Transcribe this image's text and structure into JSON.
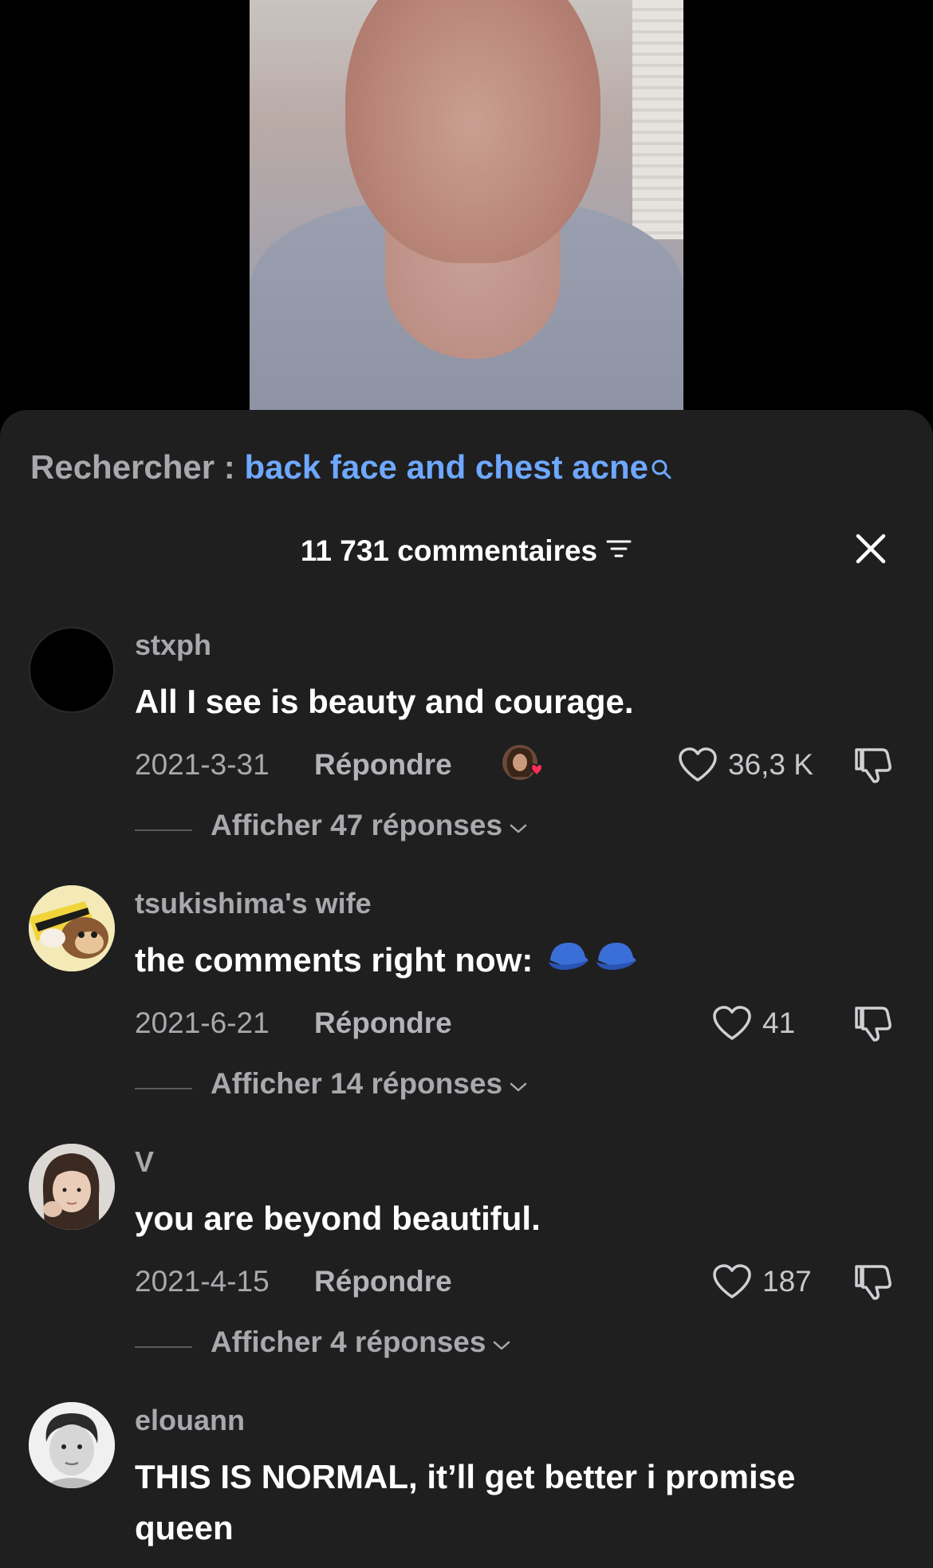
{
  "search": {
    "prefix": "Rechercher : ",
    "term": "back face and chest acne",
    "icon": "search-icon"
  },
  "header": {
    "count_label": "11 731 commentaires",
    "sort_icon": "sort-icon",
    "close_icon": "close-icon"
  },
  "colors": {
    "sheet_background": "#1f1f20",
    "accent_link": "#6ea8ff",
    "muted_text": "#a9a9ad",
    "liked_badge": "#fe2c55"
  },
  "comments": [
    {
      "username": "stxph",
      "text": "All I see is beauty and courage.",
      "date": "2021-3-31",
      "reply_label": "Répondre",
      "liked_by_creator": true,
      "likes": "36,3 K",
      "replies_label": "Afficher 47 réponses"
    },
    {
      "username": "tsukishima's wife",
      "text": "the comments right now:",
      "date": "2021-6-21",
      "reply_label": "Répondre",
      "liked_by_creator": false,
      "likes": "41",
      "replies_label": "Afficher 14 réponses"
    },
    {
      "username": "V",
      "text": "you are beyond beautiful.",
      "date": "2021-4-15",
      "reply_label": "Répondre",
      "liked_by_creator": false,
      "likes": "187",
      "replies_label": "Afficher 4 réponses"
    },
    {
      "username": "elouann",
      "text": "THIS IS NORMAL, it’ll get better i promise queen"
    }
  ]
}
